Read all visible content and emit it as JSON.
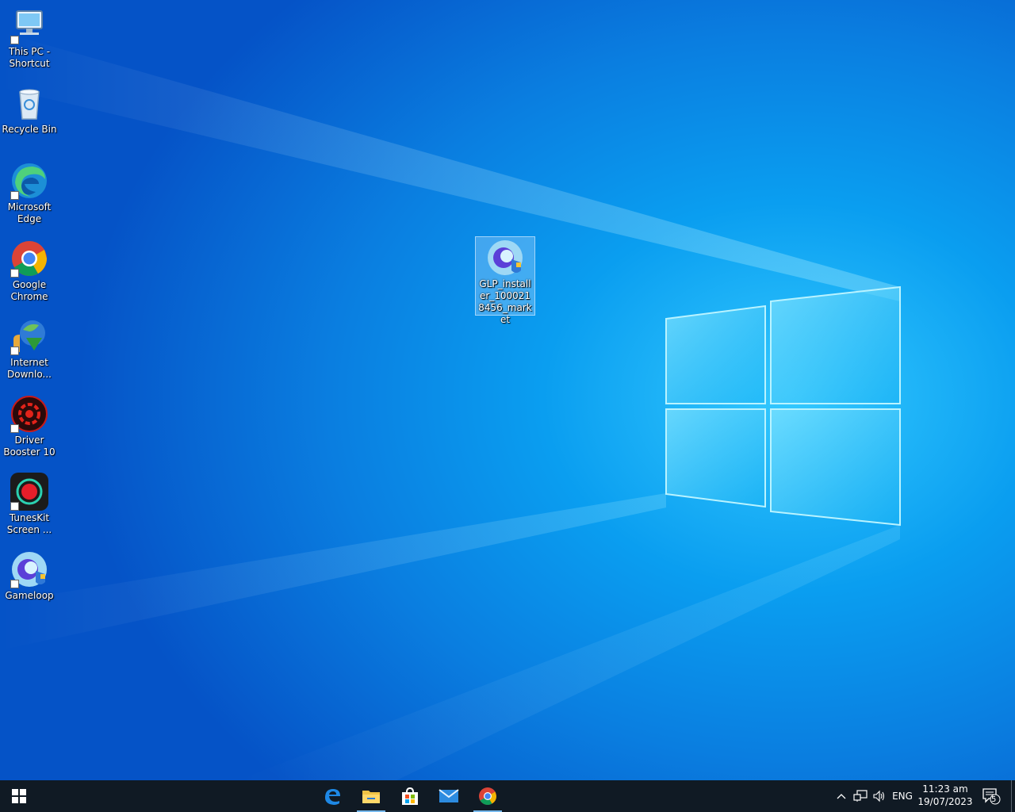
{
  "desktop": {
    "icons": [
      {
        "label": "This PC - Shortcut",
        "icon": "computer-icon"
      },
      {
        "label": "Recycle Bin",
        "icon": "recycle-bin-icon"
      },
      {
        "label": "Microsoft Edge",
        "icon": "edge-icon"
      },
      {
        "label": "Google Chrome",
        "icon": "chrome-icon"
      },
      {
        "label": "Internet Downlo...",
        "icon": "internet-download-manager-icon"
      },
      {
        "label": "Driver Booster 10",
        "icon": "driver-booster-icon"
      },
      {
        "label": "TunesKit Screen ...",
        "icon": "tuneskit-icon"
      },
      {
        "label": "Gameloop",
        "icon": "gameloop-icon"
      }
    ],
    "selected_file": {
      "label": "GLP_installer_1000218456_market",
      "icon": "gameloop-installer-icon"
    }
  },
  "taskbar": {
    "start": "windows-start-icon",
    "pinned": [
      {
        "name": "edge",
        "icon": "edge-icon",
        "active": false
      },
      {
        "name": "file-explorer",
        "icon": "folder-icon",
        "active": true
      },
      {
        "name": "microsoft-store",
        "icon": "store-icon",
        "active": false
      },
      {
        "name": "mail",
        "icon": "mail-icon",
        "active": false
      },
      {
        "name": "chrome",
        "icon": "chrome-icon",
        "active": true
      }
    ],
    "tray": {
      "language": "ENG",
      "time": "11:23 am",
      "date": "19/07/2023",
      "notification_count": "5"
    }
  },
  "colors": {
    "taskbar_bg": "#101a24",
    "accent": "#76b9ed"
  }
}
